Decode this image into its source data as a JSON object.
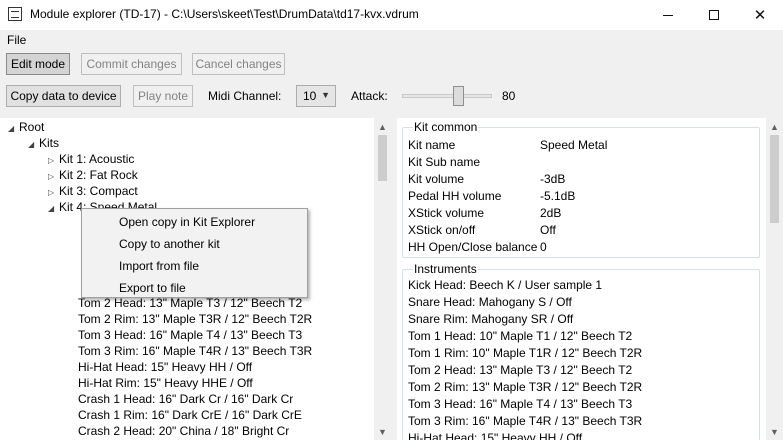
{
  "window": {
    "title": "Module explorer (TD-17) - C:\\Users\\skeet\\Test\\DrumData\\td17-kvx.vdrum"
  },
  "menu": {
    "file_label": "File"
  },
  "toolbar": {
    "edit_mode_label": "Edit mode",
    "commit_label": "Commit changes",
    "cancel_label": "Cancel changes",
    "copy_data_label": "Copy data to device",
    "play_note_label": "Play note",
    "midi_channel_label": "Midi Channel:",
    "midi_channel_value": "10",
    "attack_label": "Attack:",
    "attack_value": "80",
    "attack_level": 0.58
  },
  "tree": {
    "root_label": "Root",
    "kits_label": "Kits",
    "kits": [
      "Kit 1: Acoustic",
      "Kit 2: Fat Rock",
      "Kit 3: Compact",
      "Kit 4: Speed Metal"
    ],
    "kit4_children": [
      "Tom 2 Head: 13\" Maple T3 / 12\" Beech T2",
      "Tom 2 Rim: 13\" Maple T3R / 12\" Beech T2R",
      "Tom 3 Head: 16\" Maple T4 / 13\" Beech T3",
      "Tom 3 Rim: 16\" Maple T4R / 13\" Beech T3R",
      "Hi-Hat Head: 15\" Heavy HH / Off",
      "Hi-Hat Rim: 15\" Heavy HHE / Off",
      "Crash 1 Head: 16\" Dark Cr / 16\" Dark Cr",
      "Crash 1 Rim: 16\" Dark CrE / 16\" Dark CrE",
      "Crash 2 Head: 20\" China / 18\" Bright Cr"
    ]
  },
  "context_menu": {
    "items": [
      "Open copy in Kit Explorer",
      "Copy to another kit",
      "Import from file",
      "Export to file"
    ]
  },
  "kit_common": {
    "title": "Kit common",
    "rows": [
      {
        "key": "Kit name",
        "value": "Speed Metal"
      },
      {
        "key": "Kit Sub name",
        "value": ""
      },
      {
        "key": "Kit volume",
        "value": "-3dB"
      },
      {
        "key": "Pedal HH volume",
        "value": "-5.1dB"
      },
      {
        "key": "XStick volume",
        "value": "2dB"
      },
      {
        "key": "XStick on/off",
        "value": "Off"
      },
      {
        "key": "HH Open/Close balance",
        "value": "0"
      }
    ]
  },
  "instruments": {
    "title": "Instruments",
    "rows": [
      "Kick Head: Beech K / User sample 1",
      "Snare Head: Mahogany S / Off",
      "Snare Rim: Mahogany SR / Off",
      "Tom 1 Head: 10\" Maple T1 / 12\" Beech T2",
      "Tom 1 Rim: 10\" Maple T1R / 12\" Beech T2R",
      "Tom 2 Head: 13\" Maple T3 / 12\" Beech T2",
      "Tom 2 Rim: 13\" Maple T3R / 12\" Beech T2R",
      "Tom 3 Head: 16\" Maple T4 / 13\" Beech T3",
      "Tom 3 Rim: 16\" Maple T4R / 13\" Beech T3R",
      "Hi-Hat Head: 15\" Heavy HH / Off"
    ]
  },
  "icons": {
    "collapsed": "triangle-right-icon",
    "expanded": "triangle-down-icon",
    "scroll_up": "chevron-up-icon",
    "scroll_down": "chevron-down-icon"
  }
}
